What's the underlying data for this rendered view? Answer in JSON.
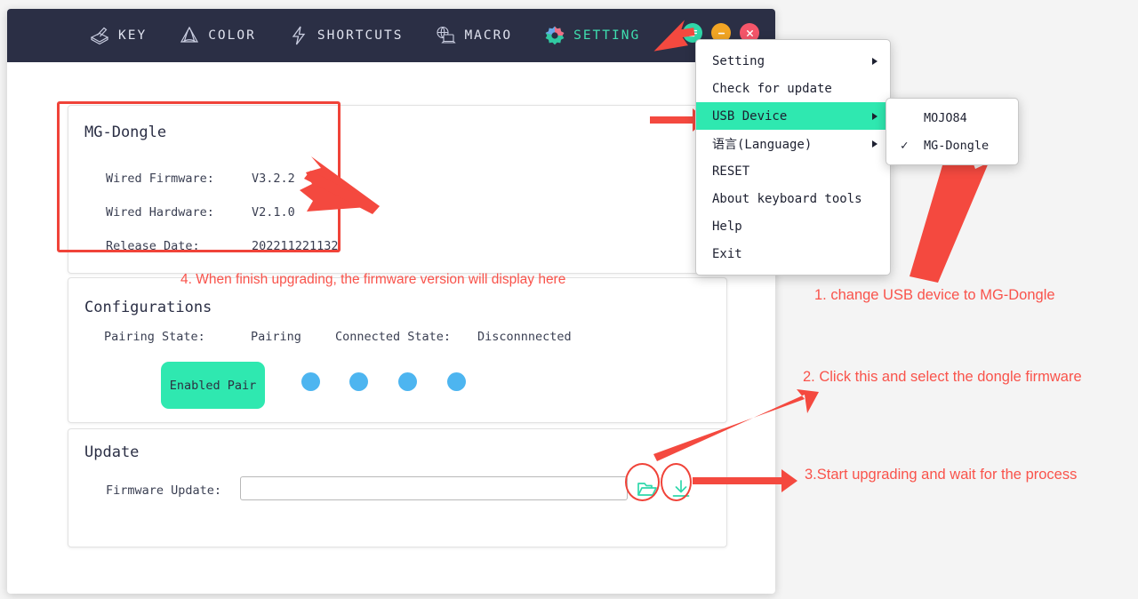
{
  "window": {
    "nav_items": [
      {
        "label": "KEY",
        "icon": "key-cap-icon",
        "active": false
      },
      {
        "label": "COLOR",
        "icon": "color-palette-icon",
        "active": false
      },
      {
        "label": "SHORTCUTS",
        "icon": "lightning-bolt-icon",
        "active": false
      },
      {
        "label": "MACRO",
        "icon": "macro-laptop-icon",
        "active": false
      },
      {
        "label": "SETTING",
        "icon": "gear-icon",
        "active": true
      }
    ],
    "window_buttons": [
      {
        "name": "menu",
        "icon": "hamburger-icon",
        "color": "#2fd6a8"
      },
      {
        "name": "minimize",
        "icon": "minus-icon",
        "color": "#f2a524"
      },
      {
        "name": "close",
        "icon": "x-icon",
        "color": "#f4566a"
      }
    ]
  },
  "device_panel": {
    "title": "MG-Dongle",
    "rows": [
      {
        "label": "Wired Firmware:",
        "value": "V3.2.2"
      },
      {
        "label": "Wired Hardware:",
        "value": "V2.1.0"
      },
      {
        "label": "Release Date:",
        "value": "202211221132"
      }
    ]
  },
  "config_panel": {
    "title": "Configurations",
    "pairing_state_label": "Pairing State:",
    "pairing_state_value": "Pairing",
    "connected_state_label": "Connected State:",
    "connected_state_value": "Disconnnected",
    "pair_button": "Enabled Pair",
    "indicator_count": 4
  },
  "update_panel": {
    "title": "Update",
    "firmware_label": "Firmware Update:",
    "firmware_value": "",
    "firmware_placeholder": "",
    "browse_icon": "open-folder-icon",
    "download_icon": "download-arrow-icon"
  },
  "menu": {
    "items": [
      {
        "label": "Setting",
        "submenu": true,
        "highlight": false
      },
      {
        "label": "Check for update",
        "submenu": false,
        "highlight": false
      },
      {
        "label": "USB Device",
        "submenu": true,
        "highlight": true
      },
      {
        "label": "语言(Language)",
        "submenu": true,
        "highlight": false
      },
      {
        "label": "RESET",
        "submenu": false,
        "highlight": false
      },
      {
        "label": "About keyboard tools",
        "submenu": false,
        "highlight": false
      },
      {
        "label": "Help",
        "submenu": false,
        "highlight": false
      },
      {
        "label": "Exit",
        "submenu": false,
        "highlight": false
      }
    ],
    "submenu_items": [
      {
        "label": "MOJO84",
        "checked": false
      },
      {
        "label": "MG-Dongle",
        "checked": true
      }
    ],
    "check_glyph": "✓"
  },
  "annotations": {
    "step1": "1. change USB device to MG-Dongle",
    "step2": "2. Click this and select the dongle firmware",
    "step3": "3.Start upgrading and wait for the process",
    "step4": "4. When finish upgrading, the firmware version will display here"
  },
  "colors": {
    "accent_teal": "#2fe8b0",
    "annotation_red": "#f9534b",
    "titlebar": "#2b2f45",
    "indicator_blue": "#4db5f0"
  }
}
